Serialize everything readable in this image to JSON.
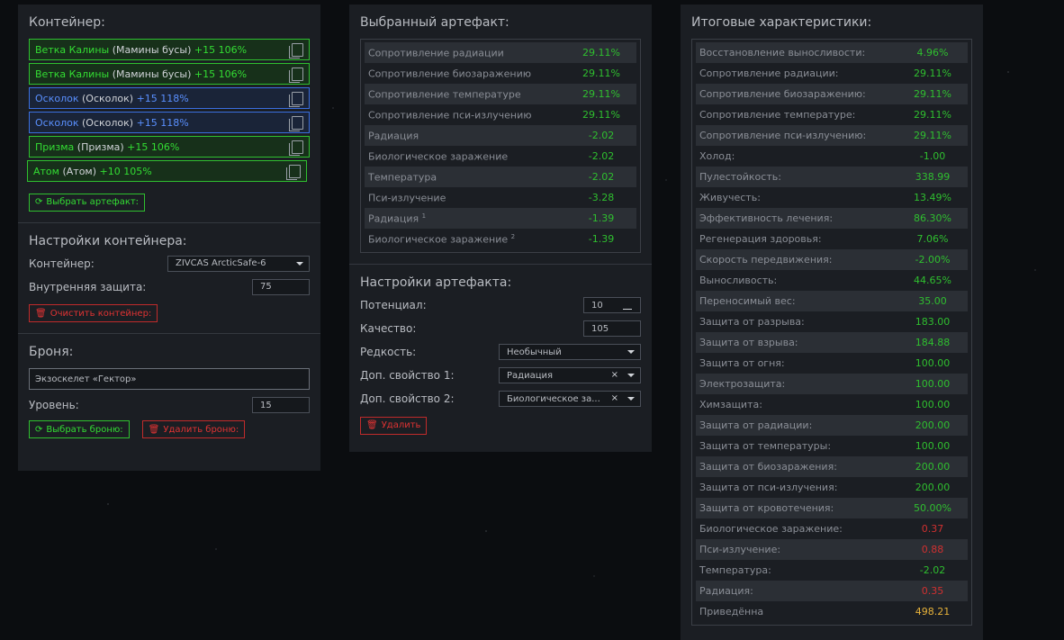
{
  "container_panel": {
    "title": "Контейнер:",
    "artifacts": [
      {
        "name": "Ветка Калины",
        "sub": "(Мамины бусы)",
        "bonus": "+15 106%",
        "color": "green"
      },
      {
        "name": "Ветка Калины",
        "sub": "(Мамины бусы)",
        "bonus": "+15 106%",
        "color": "green"
      },
      {
        "name": "Осколок",
        "sub": "(Осколок)",
        "bonus": "+15 118%",
        "color": "blue"
      },
      {
        "name": "Осколок",
        "sub": "(Осколок)",
        "bonus": "+15 118%",
        "color": "blue"
      },
      {
        "name": "Призма",
        "sub": "(Призма)",
        "bonus": "+15 106%",
        "color": "green"
      },
      {
        "name": "Атом",
        "sub": "(Атом)",
        "bonus": "+10 105%",
        "color": "green"
      }
    ],
    "select_artifact_button": "Выбрать артефакт:",
    "settings_title": "Настройки контейнера:",
    "container_label": "Контейнер:",
    "container_value": "ZIVCAS ArcticSafe-6",
    "inner_protection_label": "Внутренняя защита:",
    "inner_protection_value": "75",
    "clear_button": "Очистить контейнер:",
    "armor_title": "Броня:",
    "armor_value": "Экзоскелет «Гектор»",
    "level_label": "Уровень:",
    "level_value": "15",
    "select_armor_button": "Выбрать броню:",
    "delete_armor_button": "Удалить броню:"
  },
  "artifact_panel": {
    "title": "Выбранный артефакт:",
    "stats": [
      {
        "label": "Сопротивление радиации",
        "value": "29.11%",
        "sup": ""
      },
      {
        "label": "Сопротивление биозаражению",
        "value": "29.11%",
        "sup": ""
      },
      {
        "label": "Сопротивление температуре",
        "value": "29.11%",
        "sup": ""
      },
      {
        "label": "Сопротивление пси-излучению",
        "value": "29.11%",
        "sup": ""
      },
      {
        "label": "Радиация",
        "value": "-2.02",
        "sup": ""
      },
      {
        "label": "Биологическое заражение",
        "value": "-2.02",
        "sup": ""
      },
      {
        "label": "Температура",
        "value": "-2.02",
        "sup": ""
      },
      {
        "label": "Пси-излучение",
        "value": "-3.28",
        "sup": ""
      },
      {
        "label": "Радиация",
        "value": "-1.39",
        "sup": "1"
      },
      {
        "label": "Биологическое заражение",
        "value": "-1.39",
        "sup": "2"
      }
    ],
    "settings_title": "Настройки артефакта:",
    "potential_label": "Потенциал:",
    "potential_value": "10",
    "quality_label": "Качество:",
    "quality_value": "105",
    "rarity_label": "Редкость:",
    "rarity_value": "Необычный",
    "extra1_label": "Доп. свойство 1:",
    "extra1_value": "Радиация",
    "extra2_label": "Доп. свойство 2:",
    "extra2_value": "Биологическое за...",
    "delete_button": "Удалить"
  },
  "totals_panel": {
    "title": "Итоговые характеристики:",
    "stats": [
      {
        "label": "Восстановление выносливости:",
        "value": "4.96%",
        "tone": "green"
      },
      {
        "label": "Сопротивление радиации:",
        "value": "29.11%",
        "tone": "green"
      },
      {
        "label": "Сопротивление биозаражению:",
        "value": "29.11%",
        "tone": "green"
      },
      {
        "label": "Сопротивление температуре:",
        "value": "29.11%",
        "tone": "green"
      },
      {
        "label": "Сопротивление пси-излучению:",
        "value": "29.11%",
        "tone": "green"
      },
      {
        "label": "Холод:",
        "value": "-1.00",
        "tone": "green"
      },
      {
        "label": "Пулестойкость:",
        "value": "338.99",
        "tone": "green"
      },
      {
        "label": "Живучесть:",
        "value": "13.49%",
        "tone": "green"
      },
      {
        "label": "Эффективность лечения:",
        "value": "86.30%",
        "tone": "green"
      },
      {
        "label": "Регенерация здоровья:",
        "value": "7.06%",
        "tone": "green"
      },
      {
        "label": "Скорость передвижения:",
        "value": "-2.00%",
        "tone": "green"
      },
      {
        "label": "Выносливость:",
        "value": "44.65%",
        "tone": "green"
      },
      {
        "label": "Переносимый вес:",
        "value": "35.00",
        "tone": "green"
      },
      {
        "label": "Защита от разрыва:",
        "value": "183.00",
        "tone": "green"
      },
      {
        "label": "Защита от взрыва:",
        "value": "184.88",
        "tone": "green"
      },
      {
        "label": "Защита от огня:",
        "value": "100.00",
        "tone": "green"
      },
      {
        "label": "Электрозащита:",
        "value": "100.00",
        "tone": "green"
      },
      {
        "label": "Химзащита:",
        "value": "100.00",
        "tone": "green"
      },
      {
        "label": "Защита от радиации:",
        "value": "200.00",
        "tone": "green"
      },
      {
        "label": "Защита от температуры:",
        "value": "100.00",
        "tone": "green"
      },
      {
        "label": "Защита от биозаражения:",
        "value": "200.00",
        "tone": "green"
      },
      {
        "label": "Защита от пси-излучения:",
        "value": "200.00",
        "tone": "green"
      },
      {
        "label": "Защита от кровотечения:",
        "value": "50.00%",
        "tone": "green"
      },
      {
        "label": "Биологическое заражение:",
        "value": "0.37",
        "tone": "red"
      },
      {
        "label": "Пси-излучение:",
        "value": "0.88",
        "tone": "red"
      },
      {
        "label": "Температура:",
        "value": "-2.02",
        "tone": "green"
      },
      {
        "label": "Радиация:",
        "value": "0.35",
        "tone": "red"
      },
      {
        "label": "Приведённа",
        "value": "498.21",
        "tone": "gold"
      }
    ]
  },
  "colors": {
    "green": "#33dd33",
    "blue": "#5a90ff",
    "red": "#e03333",
    "gold": "#e7b23a"
  }
}
